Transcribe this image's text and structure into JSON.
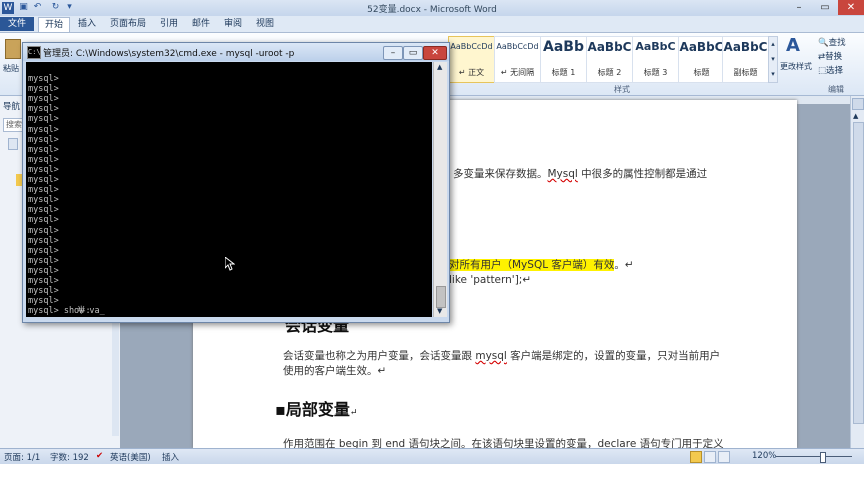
{
  "word": {
    "title": "52变量.docx - Microsoft Word",
    "tabs": [
      "文件",
      "开始",
      "插入",
      "页面布局",
      "引用",
      "邮件",
      "审阅",
      "视图"
    ],
    "paste_label": "粘贴",
    "styles": [
      {
        "sample": "AaBbCcDd",
        "label": "↵ 正文"
      },
      {
        "sample": "AaBbCcDd",
        "label": "↵ 无间隔"
      },
      {
        "sample": "AaBb",
        "label": "标题 1"
      },
      {
        "sample": "AaBbC",
        "label": "标题 2"
      },
      {
        "sample": "AaBbC",
        "label": "标题 3"
      },
      {
        "sample": "AaBbC",
        "label": "标题"
      },
      {
        "sample": "AaBbC",
        "label": "副标题"
      }
    ],
    "change_styles": "更改样式",
    "styles_group": "样式",
    "edit": {
      "find": "查找",
      "replace": "替换",
      "select": "选择",
      "group": "编辑"
    },
    "nav": {
      "title": "导航",
      "search": "搜索"
    },
    "doc": {
      "line1": "多变量来保存数据。",
      "line1_mysql": "Mysql",
      "line1_rest": " 中很多的属性控制都是通过",
      "line2_hl": "对所有用户（MySQL 客户端）有效",
      "line2_end": "。↵",
      "line3": "like 'pattern'];↵",
      "heading_partial": "会话变量",
      "para1a": "会话变量也称之为用户变量，会话变量跟 ",
      "para1_mysql": "mysql",
      "para1b": " 客户端是绑定的，设置的变量，只对当前用户",
      "para1c": "使用的客户端生效。↵",
      "heading2": "▪局部变量",
      "heading2_mark": "↵",
      "para2": "作用范围在 begin 到 end 语句块之间。在该语句块里设置的变量，declare 语句专门用于定义"
    },
    "status": {
      "page": "页面: 1/1",
      "words": "字数: 192",
      "lang": "英语(美国)",
      "mode": "插入",
      "zoom": "120%"
    }
  },
  "cmd": {
    "title": "管理员: C:\\Windows\\system32\\cmd.exe - mysql  -uroot -p",
    "prompt": "mysql>",
    "prompt_count": 23,
    "current_input": "mysql> show va_",
    "ime_text": "半:"
  },
  "colors": {
    "file_tab": "#2b5797",
    "highlight": "#fff200",
    "console_bg": "#000000",
    "console_fg": "#c0c0c0"
  }
}
